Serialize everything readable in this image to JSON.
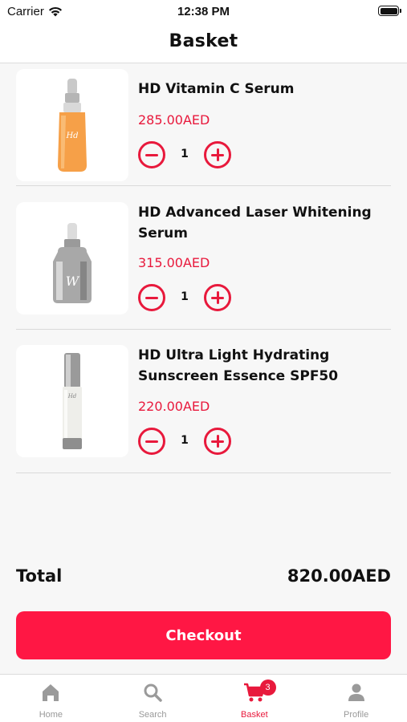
{
  "status_bar": {
    "carrier": "Carrier",
    "time": "12:38 PM"
  },
  "header": {
    "title": "Basket"
  },
  "items": [
    {
      "name": "HD Vitamin C Serum",
      "price": "285.00AED",
      "quantity": "1",
      "image_icon": "orange-serum-bottle"
    },
    {
      "name": "HD Advanced Laser Whitening Serum",
      "price": "315.00AED",
      "quantity": "1",
      "image_icon": "silver-serum-bottle"
    },
    {
      "name": "HD Ultra Light Hydrating Sunscreen Essence SPF50",
      "price": "220.00AED",
      "quantity": "1",
      "image_icon": "white-pump-bottle"
    }
  ],
  "summary": {
    "total_label": "Total",
    "total_value": "820.00AED"
  },
  "checkout": {
    "label": "Checkout"
  },
  "tab_bar": {
    "tabs": [
      {
        "label": "Home",
        "icon": "home-icon",
        "active": false
      },
      {
        "label": "Search",
        "icon": "search-icon",
        "active": false
      },
      {
        "label": "Basket",
        "icon": "cart-icon",
        "active": true,
        "badge": "3"
      },
      {
        "label": "Profile",
        "icon": "person-icon",
        "active": false
      }
    ]
  },
  "colors": {
    "accent": "#e8193c",
    "checkout_bg": "#ff1744",
    "page_bg": "#f7f7f7"
  }
}
